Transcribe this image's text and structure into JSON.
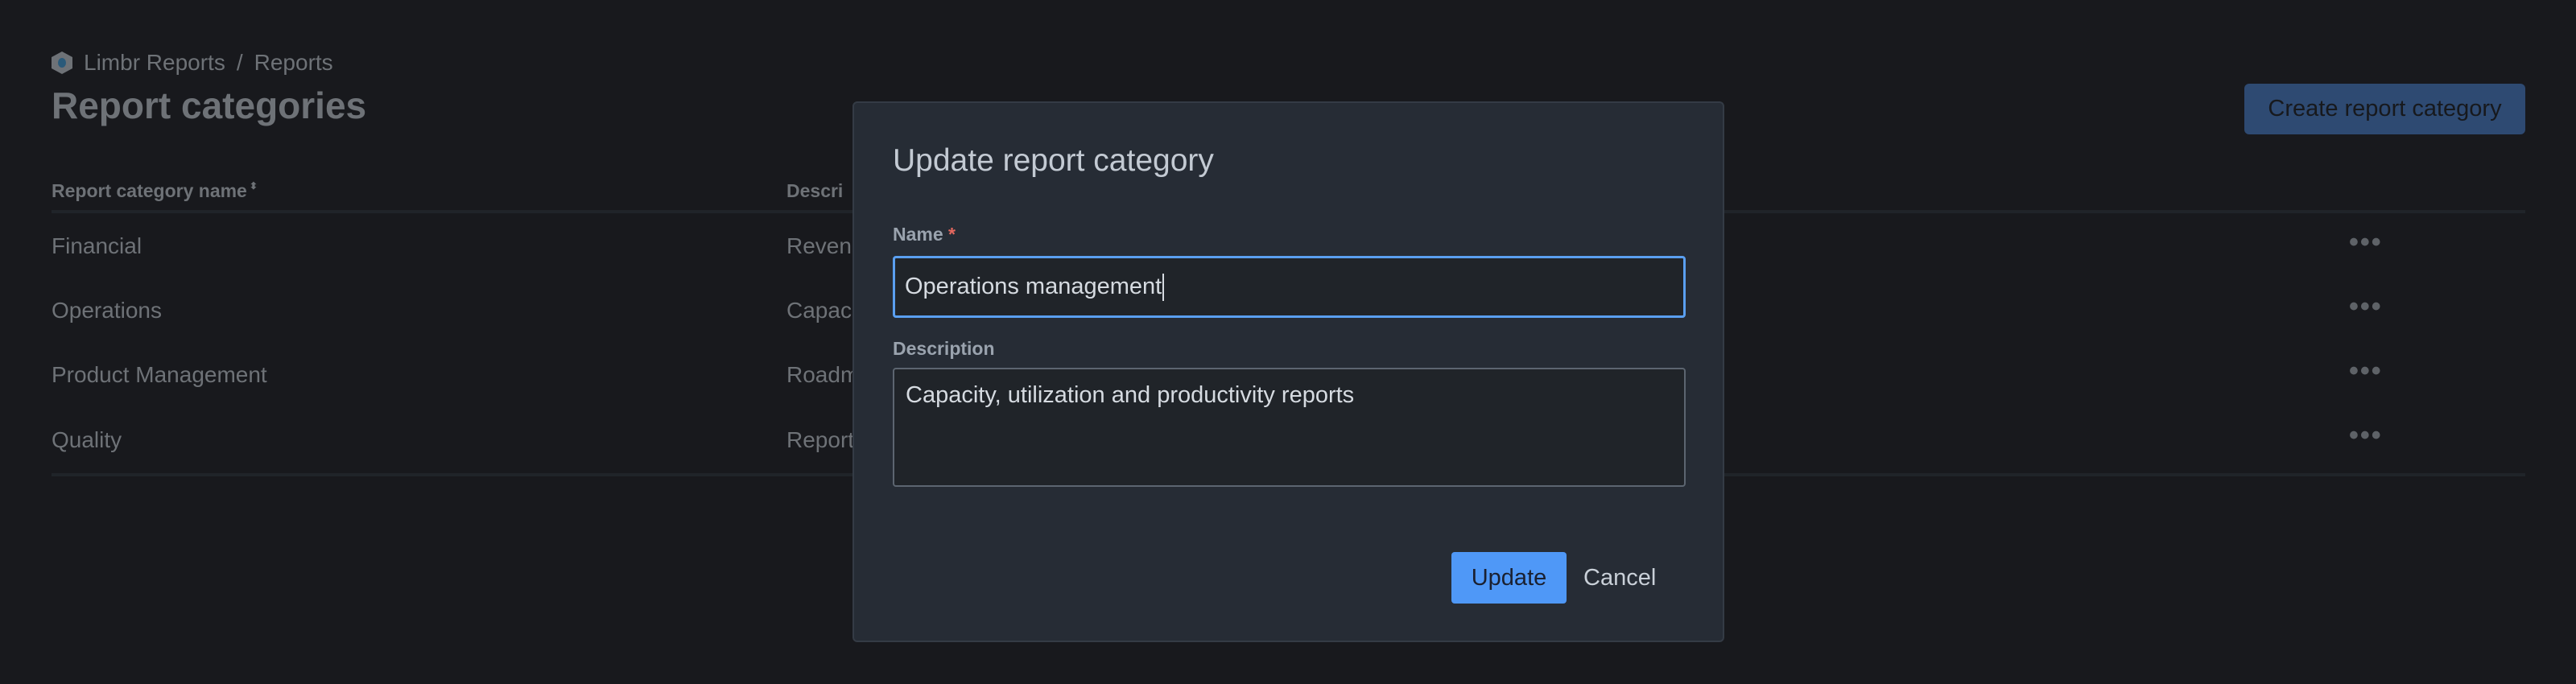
{
  "breadcrumb": {
    "app": "Limbr Reports",
    "separator": "/",
    "current": "Reports"
  },
  "page_title": "Report categories",
  "create_button": "Create report category",
  "table": {
    "headers": [
      "Report category name",
      "Descri"
    ],
    "sort_icon": "sort-icon",
    "rows": [
      {
        "name": "Financial",
        "description": "Reven"
      },
      {
        "name": "Operations",
        "description": "Capac"
      },
      {
        "name": "Product Management",
        "description": "Roadm"
      },
      {
        "name": "Quality",
        "description": "Report"
      }
    ],
    "row_action": "•••"
  },
  "modal": {
    "title": "Update report category",
    "name_label": "Name",
    "required_mark": "*",
    "name_value": "Operations management",
    "description_label": "Description",
    "description_value": "Capacity, utilization and productivity reports",
    "update_button": "Update",
    "cancel_button": "Cancel"
  },
  "colors": {
    "accent": "#4f98f7",
    "background": "#18191d",
    "modal": "#262c35"
  }
}
